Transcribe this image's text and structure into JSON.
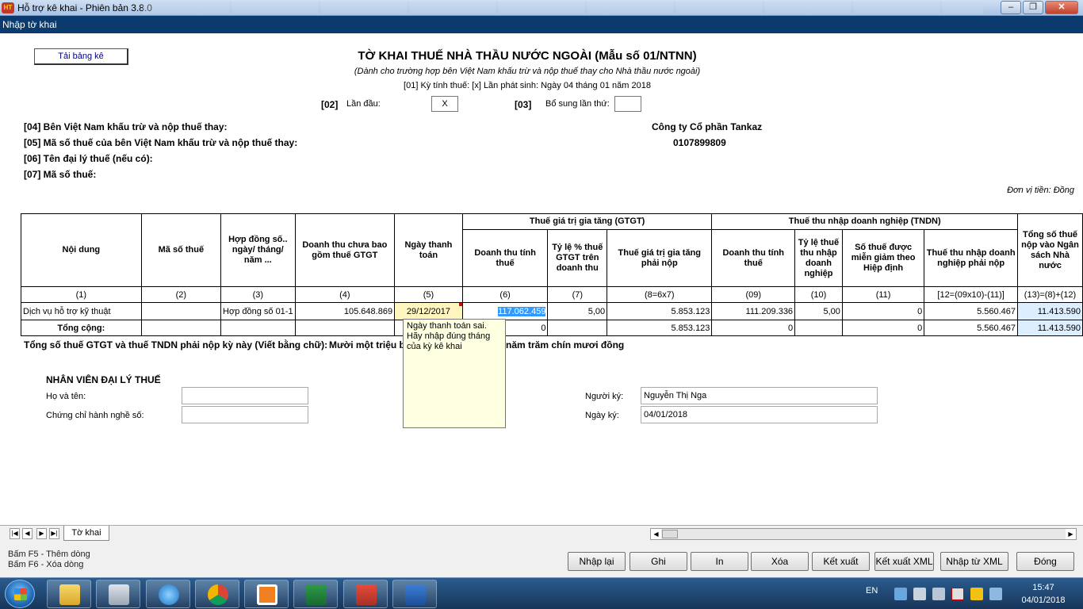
{
  "window": {
    "title": "Hỗ trợ kê khai - Phiên bản 3.8.0",
    "subtitle": "Nhập tờ khai"
  },
  "form": {
    "load_button": "Tải bảng kê",
    "title": "TỜ KHAI THUẾ NHÀ THẦU NƯỚC NGOÀI (Mẫu số 01/NTNN)",
    "subtitle": "(Dành cho trường hợp bên Việt Nam khấu trừ và nộp thuế thay cho Nhà thầu nước ngoài)",
    "period": "[01] Kỳ tính thuế: [x] Lần phát sinh: Ngày 04 tháng 01 năm 2018",
    "first_time_code": "[02]",
    "first_time_label": "Lần đầu:",
    "first_time_value": "X",
    "supplement_code": "[03]",
    "supplement_label": "Bổ sung lần thứ:",
    "supplement_value": "",
    "field04_label": "[04] Bên Việt Nam khấu trừ và nộp thuế thay:",
    "field04_value": "Công ty Cổ phần Tankaz",
    "field05_label": "[05] Mã số thuế của bên Việt Nam khấu trừ và nộp thuế thay:",
    "field05_value": "0107899809",
    "field06_label": "[06] Tên đại lý thuế (nếu có):",
    "field07_label": "[07] Mã số thuế:",
    "currency_unit": "Đơn vị tiền: Đồng"
  },
  "table": {
    "group_headers": {
      "vat": "Thuế giá trị gia tăng (GTGT)",
      "cit": "Thuế thu nhập doanh nghiệp (TNDN)"
    },
    "headers": [
      "Nội dung",
      "Mã số thuế",
      "Hợp đồng số.. ngày/ tháng/ năm ...",
      "Doanh thu chưa bao gồm thuế GTGT",
      "Ngày thanh toán",
      "Doanh thu tính thuế",
      "Tỷ lệ % thuế GTGT trên doanh thu",
      "Thuế giá trị gia tăng phải nộp",
      "Doanh thu tính thuế",
      "Tỷ lệ thuế thu nhập doanh nghiệp",
      "Số thuế được miễn giảm theo Hiệp định",
      "Thuế thu nhập doanh nghiệp phải nộp",
      "Tổng số thuế nộp vào Ngân sách Nhà nước"
    ],
    "col_numbers": [
      "(1)",
      "(2)",
      "(3)",
      "(4)",
      "(5)",
      "(6)",
      "(7)",
      "(8=6x7)",
      "(09)",
      "(10)",
      "(11)",
      "[12=(09x10)-(11)]",
      "(13)=(8)+(12)"
    ],
    "row": [
      "Dịch vụ hỗ trợ kỹ thuật",
      "",
      "Hợp đồng số 01-1",
      "105.648.869",
      "29/12/2017",
      "117.062.459",
      "5,00",
      "5.853.123",
      "111.209.336",
      "5,00",
      "0",
      "5.560.467",
      "11.413.590"
    ],
    "total": {
      "label": "Tổng cộng:",
      "c6": "0",
      "c8": "5.853.123",
      "c9": "0",
      "c11": "0",
      "c12": "5.560.467",
      "c13": "11.413.590"
    }
  },
  "tooltip": "Ngày thanh toán sai. Hãy nhập đúng tháng của kỳ kê khai",
  "words": {
    "label": "Tổng số thuế GTGT và thuế TNDN phải nộp kỳ này (Viết bằng chữ):",
    "value": "Mười một triệu b",
    "value_tail": "năm trăm chín mươi đồng"
  },
  "signature": {
    "agent_title": "NHÂN VIÊN ĐẠI LÝ THUẾ",
    "name_label": "Họ và tên:",
    "name_value": "",
    "cert_label": "Chứng chỉ hành nghề số:",
    "cert_value": "",
    "signer_label": "Người ký:",
    "signer_value": "Nguyễn Thị Nga",
    "date_label": "Ngày ký:",
    "date_value": "04/01/2018"
  },
  "sheet_tab": "Tờ khai",
  "hints": [
    "Bấm F5 - Thêm dòng",
    "Bấm F6 - Xóa dòng"
  ],
  "buttons": {
    "reload": "Nhập lại",
    "save": "Ghi",
    "print": "In",
    "delete": "Xóa",
    "export": "Kết xuất",
    "export_xml": "Kết xuất XML",
    "import_xml": "Nhập từ XML",
    "close": "Đóng"
  },
  "taskbar": {
    "language": "EN",
    "time": "15:47",
    "date": "04/01/2018"
  },
  "colors": {
    "subbar": "#0b3a6e",
    "selected_cell": "#3399ff",
    "date_cell": "#fff6bf",
    "tooltip": "#ffffe1"
  }
}
